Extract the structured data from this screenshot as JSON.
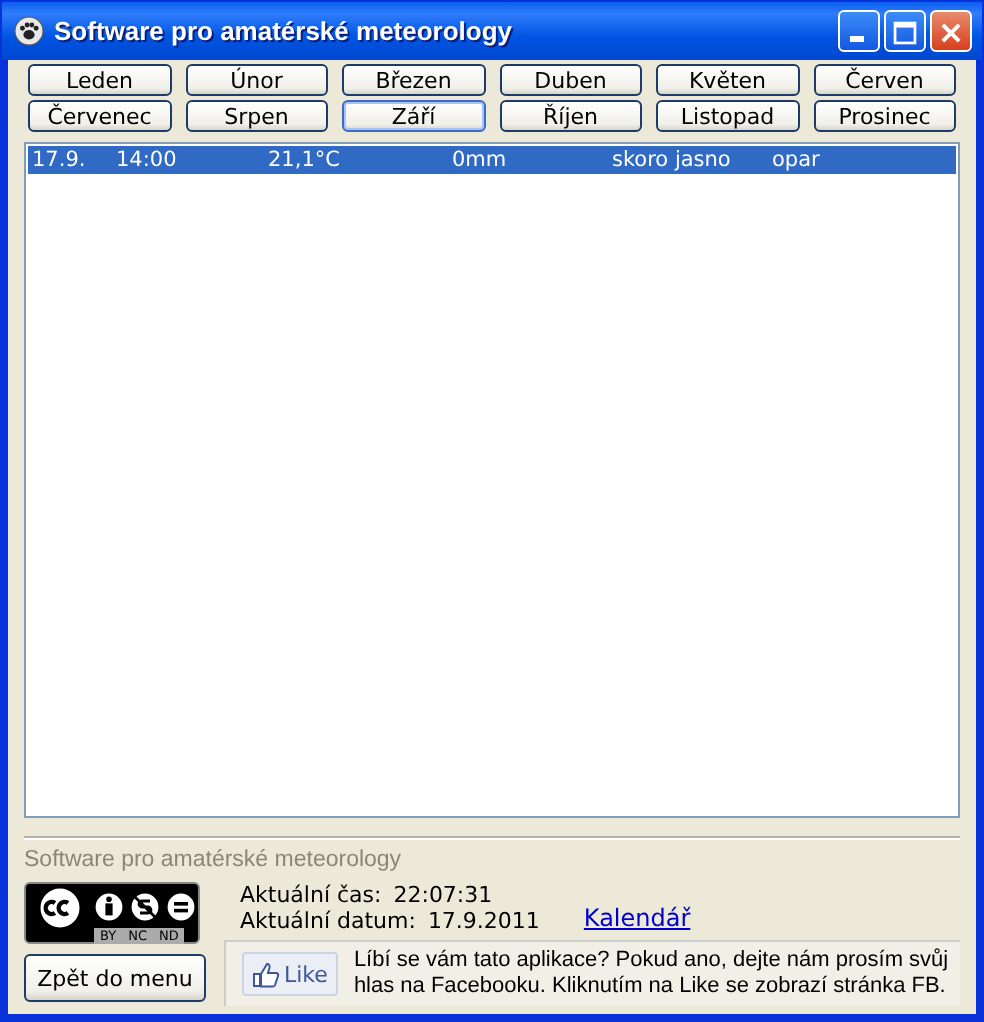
{
  "window": {
    "title": "Software pro amatérské meteorology"
  },
  "months": [
    {
      "label": "Leden",
      "selected": false
    },
    {
      "label": "Únor",
      "selected": false
    },
    {
      "label": "Březen",
      "selected": false
    },
    {
      "label": "Duben",
      "selected": false
    },
    {
      "label": "Květen",
      "selected": false
    },
    {
      "label": "Červen",
      "selected": false
    },
    {
      "label": "Červenec",
      "selected": false
    },
    {
      "label": "Srpen",
      "selected": false
    },
    {
      "label": "Září",
      "selected": true
    },
    {
      "label": "Říjen",
      "selected": false
    },
    {
      "label": "Listopad",
      "selected": false
    },
    {
      "label": "Prosinec",
      "selected": false
    }
  ],
  "records": [
    {
      "selected": true,
      "cells": [
        "17.9.",
        "14:00",
        "21,1°C",
        "0mm",
        "skoro jasno",
        "opar"
      ]
    }
  ],
  "footer": {
    "app_name": "Software pro amatérské meteorology",
    "license_labels": [
      "BY",
      "NC",
      "ND"
    ],
    "time_label": "Aktuální čas:",
    "time_value": "22:07:31",
    "date_label": "Aktuální datum:",
    "date_value": "17.9.2011",
    "calendar_link": "Kalendář",
    "back_button": "Zpět do menu",
    "like_button": "Like",
    "like_text": "Líbí se vám tato aplikace? Pokud ano, dejte nám prosím svůj hlas na Facebooku. Kliknutím na Like se zobrazí stránka FB."
  }
}
